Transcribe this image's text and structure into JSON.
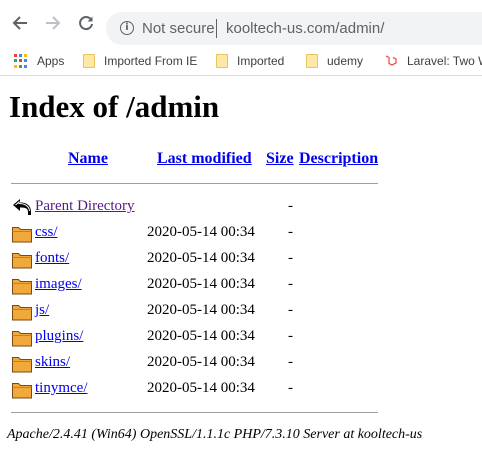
{
  "browser": {
    "security_label": "Not secure",
    "url": "kooltech-us.com/admin/"
  },
  "bookmarks": [
    {
      "label": "Apps",
      "icon": "apps-grid-icon"
    },
    {
      "label": "Imported From IE",
      "icon": "folder-icon"
    },
    {
      "label": "Imported",
      "icon": "folder-icon"
    },
    {
      "label": "udemy",
      "icon": "folder-icon"
    },
    {
      "label": "Laravel: Two W",
      "icon": "laravel-icon"
    }
  ],
  "page": {
    "title": "Index of /admin",
    "columns": {
      "name": "Name",
      "last_modified": "Last modified",
      "size": "Size",
      "description": "Description"
    },
    "parent": {
      "name": "Parent Directory",
      "size": "-",
      "icon": "back-arrow-icon"
    },
    "entries": [
      {
        "name": "css/",
        "modified": "2020-05-14 00:34",
        "size": "-",
        "icon": "folder-icon"
      },
      {
        "name": "fonts/",
        "modified": "2020-05-14 00:34",
        "size": "-",
        "icon": "folder-icon"
      },
      {
        "name": "images/",
        "modified": "2020-05-14 00:34",
        "size": "-",
        "icon": "folder-icon"
      },
      {
        "name": "js/",
        "modified": "2020-05-14 00:34",
        "size": "-",
        "icon": "folder-icon"
      },
      {
        "name": "plugins/",
        "modified": "2020-05-14 00:34",
        "size": "-",
        "icon": "folder-icon"
      },
      {
        "name": "skins/",
        "modified": "2020-05-14 00:34",
        "size": "-",
        "icon": "folder-icon"
      },
      {
        "name": "tinymce/",
        "modified": "2020-05-14 00:34",
        "size": "-",
        "icon": "folder-icon"
      }
    ],
    "server_signature": "Apache/2.4.41 (Win64) OpenSSL/1.1.1c PHP/7.3.10 Server at kooltech-us"
  },
  "colors": {
    "link": "#0000ee",
    "visited_link": "#551a8b",
    "folder_fill": "#f2a93b",
    "omnibox_bg": "#f1f3f4"
  }
}
